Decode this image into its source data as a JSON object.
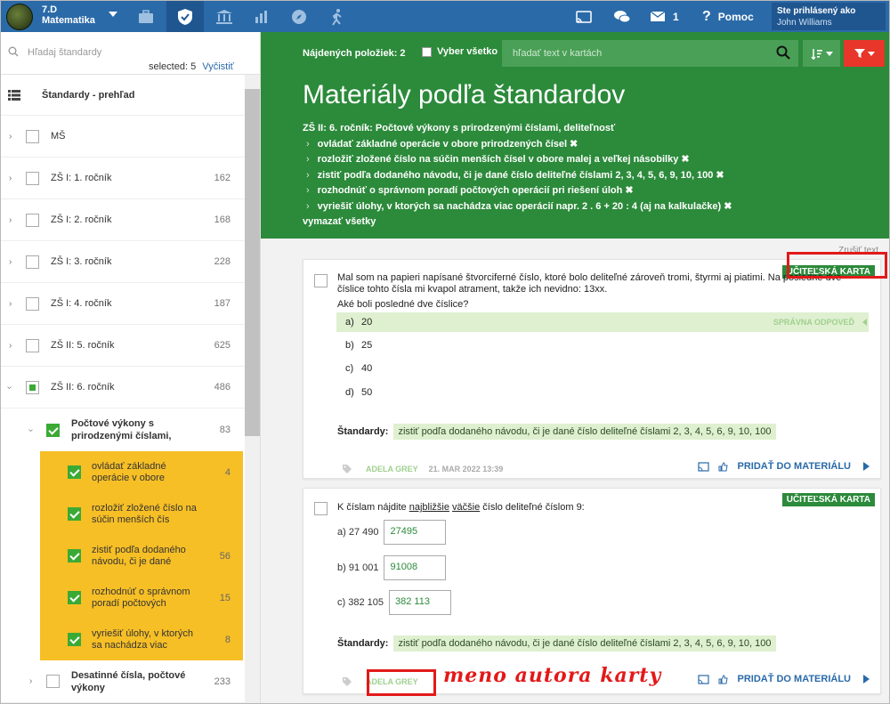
{
  "header": {
    "class_name": "7.D",
    "subject": "Matematika",
    "nav_icons": [
      "briefcase-icon",
      "shield-check-icon",
      "building-icon",
      "bar-chart-icon",
      "compass-icon",
      "running-icon"
    ],
    "cast_icon": "cast-icon",
    "chat_icon": "chat-icon",
    "mail_count": "1",
    "help_label": "Pomoc",
    "login_label": "Ste prihlásený ako",
    "user_name": "John Williams"
  },
  "sidebar": {
    "search_placeholder": "Hľadaj štandardy",
    "selected_text": "selected: 5",
    "clear_label": "Vyčistiť",
    "overview_label": "Štandardy - prehľad",
    "items": [
      {
        "label": "MŠ",
        "count": ""
      },
      {
        "label": "ZŠ I: 1. ročník",
        "count": "162"
      },
      {
        "label": "ZŠ I: 2. ročník",
        "count": "168"
      },
      {
        "label": "ZŠ I: 3. ročník",
        "count": "228"
      },
      {
        "label": "ZŠ I: 4. ročník",
        "count": "187"
      },
      {
        "label": "ZŠ II: 5. ročník",
        "count": "625"
      },
      {
        "label": "ZŠ II: 6. ročník",
        "count": "486"
      }
    ],
    "sub_item": {
      "label": "Počtové výkony s prirodzenými číslami,",
      "count": "83"
    },
    "leaves": [
      {
        "label": "ovládať základné operácie v obore",
        "count": "4"
      },
      {
        "label": "rozložiť zložené číslo na súčin menších čís",
        "count": ""
      },
      {
        "label": "zistiť podľa dodaného návodu, či je dané",
        "count": "56"
      },
      {
        "label": "rozhodnúť o správnom poradí počtových",
        "count": "15"
      },
      {
        "label": "vyriešiť úlohy, v ktorých sa nachádza viac",
        "count": "8"
      }
    ],
    "next_item": {
      "label": "Desatinné čísla, počtové výkony",
      "count": "233"
    }
  },
  "toolbar": {
    "found_label": "Nájdených položiek: 2",
    "select_all_label": "Vyber všetko",
    "search_placeholder": "hľadať text v kartách"
  },
  "page": {
    "title": "Materiály podľa štandardov",
    "crumb": "ZŠ II: 6. ročník: Počtové výkony s prirodzenými číslami, deliteľnosť",
    "standards": [
      "ovládať základné operácie v obore prirodzených čísel",
      "rozložiť zložené číslo na súčin menších čísel v obore malej a veľkej násobilky",
      "zistiť podľa dodaného návodu, či je dané číslo deliteľné číslami 2, 3, 4, 5, 6, 9, 10, 100",
      "rozhodnúť o správnom poradí počtových operácií pri riešení úloh",
      "vyriešiť úlohy, v ktorých sa nachádza viac operácií napr. 2 . 6 + 20 : 4 (aj na kalkulačke)"
    ],
    "clear_all": "vymazať všetky",
    "clear_text_hint": "Zrušiť text"
  },
  "cards": [
    {
      "badge": "UČITEĽSKÁ KARTA",
      "question_line1": "Mal som na papieri napísané štvorciferné číslo, ktoré bolo deliteľné zároveň tromi, štyrmi aj piatimi. Na posledné dve",
      "question_line2": "číslice tohto čísla mi kvapol atrament, takže ich nevidno: 13xx.",
      "question_line3": "Aké boli posledné dve číslice?",
      "answers": [
        {
          "letter": "a)",
          "value": "20"
        },
        {
          "letter": "b)",
          "value": "25"
        },
        {
          "letter": "c)",
          "value": "40"
        },
        {
          "letter": "d)",
          "value": "50"
        }
      ],
      "correct_label": "SPRÁVNA ODPOVEĎ",
      "standards_label": "Štandardy:",
      "standard": "zistiť podľa dodaného návodu, či je dané číslo deliteľné číslami 2, 3, 4, 5, 6, 9, 10, 100",
      "author": "ADELA GREY",
      "date": "21. MAR 2022 13:39",
      "add_label": "PRIDAŤ DO MATERIÁLU"
    },
    {
      "badge": "UČITEĽSKÁ KARTA",
      "question_pre": "K číslam nájdite ",
      "question_u1": "najbližšie",
      "question_mid": " ",
      "question_u2": "väčšie",
      "question_post": " číslo deliteľné číslom 9:",
      "rows": [
        {
          "label": "a) 27 490",
          "value": "27495"
        },
        {
          "label": "b) 91 001",
          "value": "91008"
        },
        {
          "label": "c) 382 105",
          "value": "382 113"
        }
      ],
      "standards_label": "Štandardy:",
      "standard": "zistiť podľa dodaného návodu, či je dané číslo deliteľné číslami 2, 3, 4, 5, 6, 9, 10, 100",
      "author": "ADELA GREY",
      "add_label": "PRIDAŤ DO MATERIÁLU"
    }
  ],
  "annotation": {
    "handwritten": "meno autora karty",
    "color": "#e31919"
  }
}
